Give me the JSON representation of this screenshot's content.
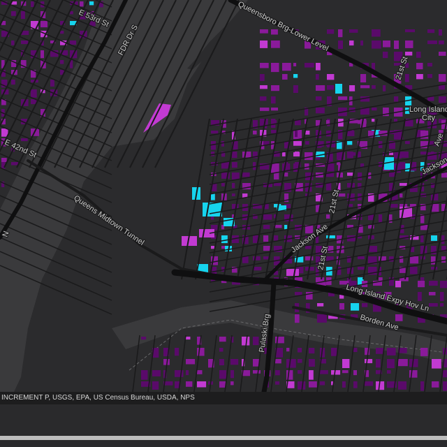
{
  "map": {
    "labels": {
      "e53": "E 53rd St",
      "fdr": "FDR Dr S",
      "queensboro": "Queensboro Brg-Lower Level",
      "st21_top": "21st St",
      "lic": "Long Island",
      "lic2": "City",
      "jackson_right": "Jackson",
      "ave_edge": "Ave",
      "e42": "E 42nd St",
      "midtown": "Queens Midtown Tunnel",
      "st21_mid": "21st St",
      "jackson_ave": "Jackson Ave",
      "st21_low": "21st St",
      "lie": "Long Island Expy Hov Ln",
      "borden": "Borden Ave",
      "pulaski": "Pulaski Brg",
      "n_edge": "N"
    },
    "colors": {
      "background": "#2b2b2d",
      "water": "#3a3a3c",
      "street": "#1a1a1b",
      "highway": "#0f0f10",
      "building_low": "#5a0a6a",
      "building_mid": "#8a1a9a",
      "building_high": "#c23ad2",
      "building_cyan": "#16d4ee"
    }
  },
  "attribution": {
    "text": "INCREMENT P, USGS, EPA, US Census Bureau, USDA, NPS"
  }
}
